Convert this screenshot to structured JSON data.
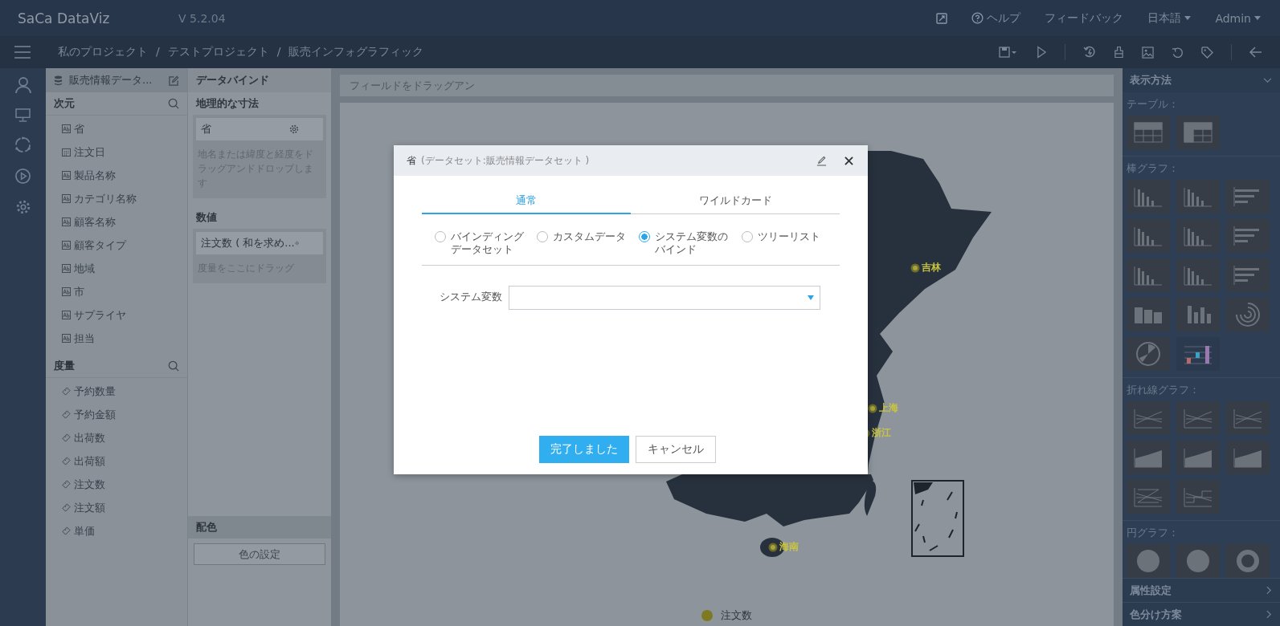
{
  "app": {
    "logo": "SaCa DataViz",
    "version": "V 5.2.04"
  },
  "top_menu": [
    {
      "kind": "icon"
    },
    {
      "kind": "help",
      "label": "ヘルプ"
    },
    {
      "kind": "link",
      "label": "フィードバック"
    },
    {
      "kind": "dropdown",
      "label": "日本語"
    },
    {
      "kind": "dropdown",
      "label": "Admin"
    }
  ],
  "breadcrumb": {
    "separator": "/",
    "items": [
      "私のプロジェクト",
      "テストプロジェクト",
      "販売インフォグラフィック"
    ]
  },
  "dataset": {
    "title": "販売情報データ...",
    "dimensions": {
      "title": "次元",
      "items": [
        {
          "label": "省",
          "kind": "text"
        },
        {
          "label": "注文日",
          "kind": "date"
        },
        {
          "label": "製品名称",
          "kind": "text"
        },
        {
          "label": "カテゴリ名称",
          "kind": "text"
        },
        {
          "label": "顧客名称",
          "kind": "text"
        },
        {
          "label": "顧客タイプ",
          "kind": "text"
        },
        {
          "label": "地域",
          "kind": "text"
        },
        {
          "label": "市",
          "kind": "text"
        },
        {
          "label": "サプライヤ",
          "kind": "text"
        },
        {
          "label": "担当",
          "kind": "text"
        }
      ]
    },
    "measures": {
      "title": "度量",
      "items": [
        "予約数量",
        "予約金額",
        "出荷数",
        "出荷額",
        "注文数",
        "注文額",
        "単価"
      ]
    }
  },
  "binding": {
    "title": "データバインド",
    "geo": {
      "title": "地理的な寸法",
      "field": "省",
      "hint": "地名または緯度と経度をドラッグアンドドロップします"
    },
    "values": {
      "title": "数値",
      "field": "注文数 ( 和を求め...",
      "hint": "度量をここにドラッグ"
    },
    "color": {
      "title": "配色",
      "button": "色の設定"
    }
  },
  "canvas": {
    "drop_hint": "フィールドをドラッグアン",
    "map_labels": [
      {
        "label": "吉林"
      },
      {
        "label": "上海"
      },
      {
        "label": "浙江"
      },
      {
        "label": "海南"
      }
    ],
    "legend": "注文数"
  },
  "dialog": {
    "field": "省",
    "title": "(データセット:販売情報データセット )",
    "tabs": [
      {
        "label": "通常",
        "selected": true
      },
      {
        "label": "ワイルドカード",
        "selected": false
      }
    ],
    "options": [
      {
        "label": "バインディングデータセット",
        "selected": false
      },
      {
        "label": "カスタムデータ",
        "selected": false
      },
      {
        "label": "システム変数のバインド",
        "selected": true
      },
      {
        "label": "ツリーリスト",
        "selected": false
      }
    ],
    "field_label": "システム変数",
    "buttons": [
      {
        "label": "完了しました",
        "kind": "primary"
      },
      {
        "label": "キャンセル",
        "kind": "secondary"
      }
    ]
  },
  "side_panel": {
    "title": "表示方法",
    "sections": [
      {
        "title": "テーブル："
      },
      {
        "title": "棒グラフ："
      },
      {
        "title": "折れ線グラフ："
      },
      {
        "title": "円グラフ："
      }
    ],
    "footer": [
      "属性設定",
      "色分け方案"
    ]
  }
}
